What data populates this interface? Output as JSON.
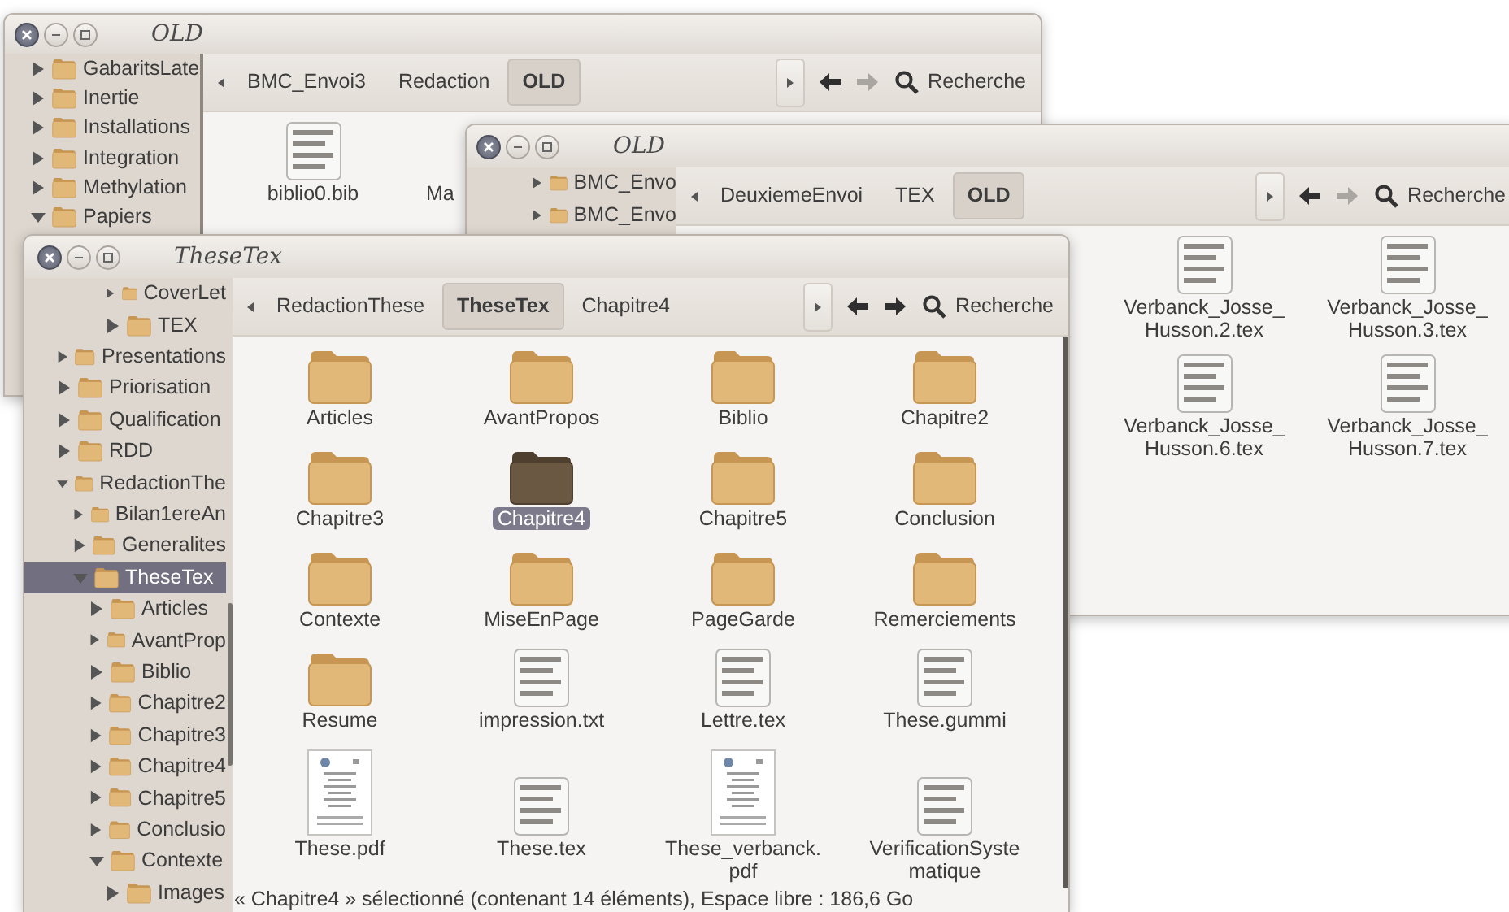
{
  "windows": [
    {
      "title": "OLD",
      "sidebar": {
        "items": [
          {
            "label": "GabaritsLate",
            "expanded": false,
            "selected": false
          },
          {
            "label": "Inertie",
            "expanded": false,
            "selected": false
          },
          {
            "label": "Installations",
            "expanded": false,
            "selected": false
          },
          {
            "label": "Integration",
            "expanded": false,
            "selected": false
          },
          {
            "label": "Methylation",
            "expanded": false,
            "selected": false
          },
          {
            "label": "Papiers",
            "expanded": true,
            "selected": false
          }
        ]
      },
      "breadcrumbs": [
        {
          "label": "BMC_Envoi3",
          "selected": false
        },
        {
          "label": "Redaction",
          "selected": false
        },
        {
          "label": "OLD",
          "selected": true
        }
      ],
      "back_enabled": true,
      "forward_enabled": false,
      "search_label": "Recherche",
      "files": [
        {
          "name": "biblio0.bib",
          "kind": "text",
          "selected": false
        },
        {
          "name": "Ma",
          "kind": "label",
          "selected": false
        }
      ]
    },
    {
      "title": "OLD",
      "sidebar": {
        "items": [
          {
            "label": "BMC_Envo",
            "expanded": false,
            "selected": false
          },
          {
            "label": "BMC_Envo",
            "expanded": false,
            "selected": false
          }
        ]
      },
      "breadcrumbs": [
        {
          "label": "DeuxiemeEnvoi",
          "selected": false
        },
        {
          "label": "TEX",
          "selected": false
        },
        {
          "label": "OLD",
          "selected": true
        }
      ],
      "back_enabled": true,
      "forward_enabled": false,
      "search_label": "Recherche",
      "files": [
        {
          "name": "Verbanck_Josse_Husson.2.tex",
          "kind": "text",
          "selected": false
        },
        {
          "name": "Verbanck_Josse_Husson.3.tex",
          "kind": "text",
          "selected": false
        },
        {
          "name": "Verbanck_Josse_Husson.6.tex",
          "kind": "text",
          "selected": false
        },
        {
          "name": "Verbanck_Josse_Husson.7.tex",
          "kind": "text",
          "selected": false
        }
      ]
    },
    {
      "title": "TheseTex",
      "sidebar": {
        "continued": [
          {
            "label": "CoverLet",
            "expanded": false,
            "selected": false
          },
          {
            "label": "TEX",
            "expanded": false,
            "selected": false
          }
        ],
        "items": [
          {
            "label": "Presentations",
            "expanded": false,
            "selected": false
          },
          {
            "label": "Priorisation",
            "expanded": false,
            "selected": false
          },
          {
            "label": "Qualification",
            "expanded": false,
            "selected": false
          },
          {
            "label": "RDD",
            "expanded": false,
            "selected": false
          },
          {
            "label": "RedactionThe",
            "expanded": true,
            "selected": false,
            "children": [
              {
                "label": "Bilan1ereAn",
                "expanded": false,
                "selected": false
              },
              {
                "label": "Generalites",
                "expanded": false,
                "selected": false
              },
              {
                "label": "TheseTex",
                "expanded": true,
                "selected": true,
                "children": [
                  {
                    "label": "Articles",
                    "expanded": false,
                    "selected": false
                  },
                  {
                    "label": "AvantProp",
                    "expanded": false,
                    "selected": false
                  },
                  {
                    "label": "Biblio",
                    "expanded": false,
                    "selected": false
                  },
                  {
                    "label": "Chapitre2",
                    "expanded": false,
                    "selected": false
                  },
                  {
                    "label": "Chapitre3",
                    "expanded": false,
                    "selected": false
                  },
                  {
                    "label": "Chapitre4",
                    "expanded": false,
                    "selected": false
                  },
                  {
                    "label": "Chapitre5",
                    "expanded": false,
                    "selected": false
                  },
                  {
                    "label": "Conclusio",
                    "expanded": false,
                    "selected": false
                  },
                  {
                    "label": "Contexte",
                    "expanded": true,
                    "selected": false,
                    "children": [
                      {
                        "label": "Images",
                        "expanded": false,
                        "selected": false
                      }
                    ]
                  }
                ]
              }
            ]
          }
        ]
      },
      "breadcrumbs": [
        {
          "label": "RedactionThese",
          "selected": false
        },
        {
          "label": "TheseTex",
          "selected": true
        },
        {
          "label": "Chapitre4",
          "selected": false
        }
      ],
      "back_enabled": true,
      "forward_enabled": true,
      "search_label": "Recherche",
      "files": [
        {
          "name": "Articles",
          "kind": "folder",
          "selected": false
        },
        {
          "name": "AvantPropos",
          "kind": "folder",
          "selected": false
        },
        {
          "name": "Biblio",
          "kind": "folder",
          "selected": false
        },
        {
          "name": "Chapitre2",
          "kind": "folder",
          "selected": false
        },
        {
          "name": "Chapitre3",
          "kind": "folder",
          "selected": false
        },
        {
          "name": "Chapitre4",
          "kind": "folder",
          "selected": true
        },
        {
          "name": "Chapitre5",
          "kind": "folder",
          "selected": false
        },
        {
          "name": "Conclusion",
          "kind": "folder",
          "selected": false
        },
        {
          "name": "Contexte",
          "kind": "folder",
          "selected": false
        },
        {
          "name": "MiseEnPage",
          "kind": "folder",
          "selected": false
        },
        {
          "name": "PageGarde",
          "kind": "folder",
          "selected": false
        },
        {
          "name": "Remerciements",
          "kind": "folder",
          "selected": false
        },
        {
          "name": "Resume",
          "kind": "folder",
          "selected": false
        },
        {
          "name": "impression.txt",
          "kind": "text",
          "selected": false
        },
        {
          "name": "Lettre.tex",
          "kind": "text",
          "selected": false
        },
        {
          "name": "These.gummi",
          "kind": "text",
          "selected": false
        },
        {
          "name": "These.pdf",
          "kind": "pdf",
          "selected": false
        },
        {
          "name": "These.tex",
          "kind": "text",
          "selected": false
        },
        {
          "name": "These_verbanck.pdf",
          "kind": "pdf",
          "selected": false
        },
        {
          "name": "VerificationSystematique",
          "kind": "text",
          "selected": false
        }
      ],
      "status": "« Chapitre4 » sélectionné (contenant 14 éléments), Espace libre : 186,6 Go"
    }
  ]
}
